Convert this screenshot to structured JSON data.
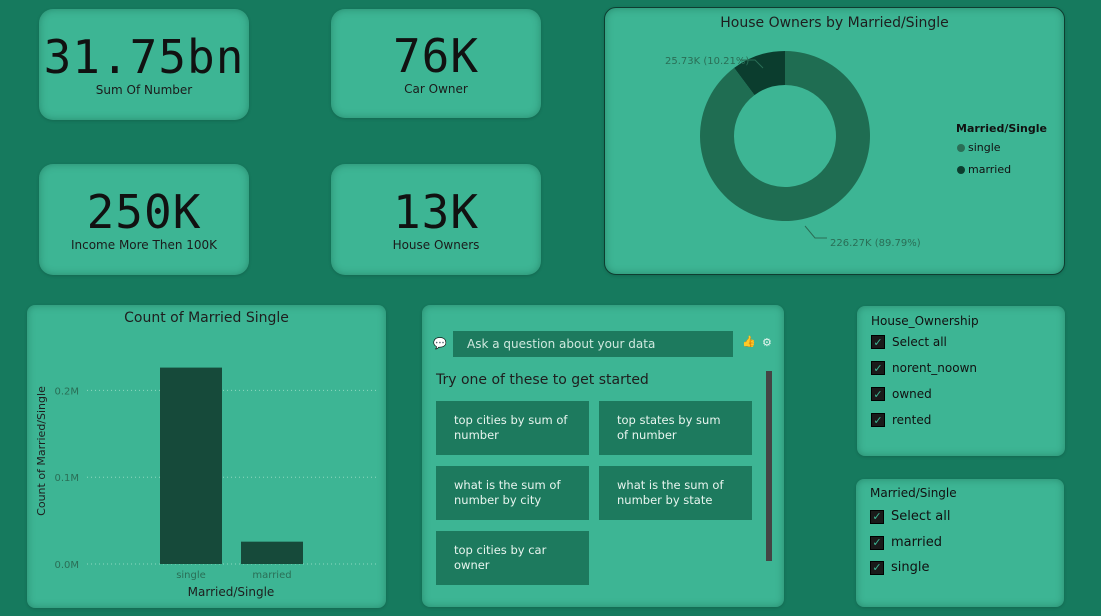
{
  "kpis": {
    "sum_of_number": {
      "value": "31.75bn",
      "label": "Sum Of Number"
    },
    "car_owner": {
      "value": "76K",
      "label": "Car Owner"
    },
    "income_more_100k": {
      "value": "250K",
      "label": "Income More Then 100K"
    },
    "house_owners": {
      "value": "13K",
      "label": "House Owners"
    }
  },
  "donut": {
    "title": "House Owners by Married/Single",
    "legend_title": "Married/Single",
    "legend": [
      {
        "name": "single",
        "color": "#2a6e56"
      },
      {
        "name": "married",
        "color": "#0b3d2e"
      }
    ],
    "slices": [
      {
        "name": "single",
        "value": 226.27,
        "label": "226.27K (89.79%)",
        "color": "#1f6d52"
      },
      {
        "name": "married",
        "value": 25.73,
        "label": "25.73K (10.21%)",
        "color": "#0b3d2e"
      }
    ]
  },
  "bar": {
    "title": "Count of Married Single",
    "chart_data": {
      "type": "bar",
      "categories": [
        "single",
        "married"
      ],
      "values": [
        226270,
        25730
      ],
      "title": "Count of Married Single",
      "xlabel": "Married/Single",
      "ylabel": "Count of Married/Single",
      "ylim": [
        0,
        250000
      ],
      "yticks": [
        {
          "value": 0,
          "label": "0.0M"
        },
        {
          "value": 100000,
          "label": "0.1M"
        },
        {
          "value": 200000,
          "label": "0.2M"
        }
      ],
      "grid": true,
      "bar_color": "#164a3a"
    }
  },
  "qa": {
    "placeholder": "Ask a question about your data",
    "hint": "Try one of these to get started",
    "suggestions": [
      "top cities by sum of number",
      "top states by sum of number",
      "what is the sum of number by city",
      "what is the sum of number by state",
      "top cities by car owner"
    ]
  },
  "slicer_house": {
    "title": "House_Ownership",
    "items": [
      "Select all",
      "norent_noown",
      "owned",
      "rented"
    ]
  },
  "slicer_married": {
    "title": "Married/Single",
    "items": [
      "Select all",
      "married",
      "single"
    ]
  }
}
